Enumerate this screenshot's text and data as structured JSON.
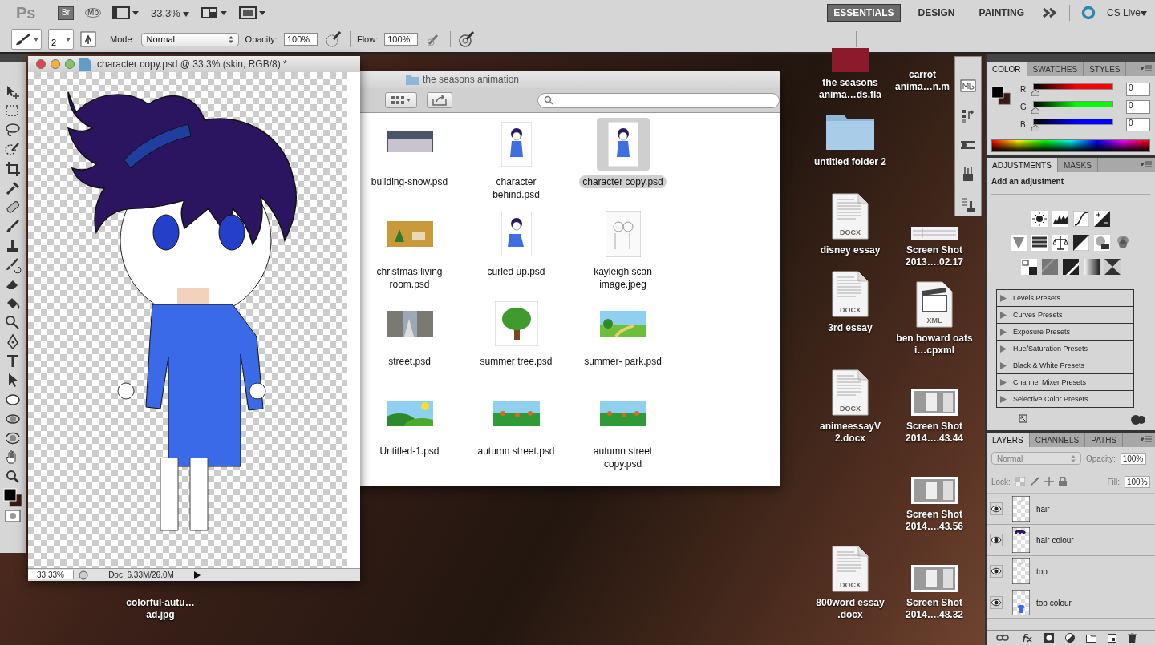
{
  "app_bar": {
    "logo": "Ps",
    "bridge": "Br",
    "mini_bridge": "Mb",
    "zoom": "33.3%",
    "cs_live": "CS Live",
    "workspaces": [
      {
        "label": "ESSENTIALS",
        "selected": true
      },
      {
        "label": "DESIGN",
        "selected": false
      },
      {
        "label": "PAINTING",
        "selected": false
      }
    ]
  },
  "options_bar": {
    "brush_size": "2",
    "mode_label": "Mode:",
    "mode": "Normal",
    "opacity_label": "Opacity:",
    "opacity": "100%",
    "flow_label": "Flow:",
    "flow": "100%"
  },
  "document": {
    "title": "character copy.psd @ 33.3% (skin, RGB/8) *",
    "zoom": "33.33%",
    "doc_info": "Doc: 6.33M/26.0M"
  },
  "finder": {
    "title": "the seasons animation",
    "files": [
      {
        "name": "building-snow.psd",
        "kind": "snow",
        "selected": false
      },
      {
        "name": "character behind.psd",
        "kind": "character",
        "selected": false
      },
      {
        "name": "character copy.psd",
        "kind": "character",
        "selected": true
      },
      {
        "name": "christmas living room.psd",
        "kind": "room",
        "selected": false
      },
      {
        "name": "curled up.psd",
        "kind": "sitting",
        "selected": false
      },
      {
        "name": "kayleigh scan image.jpeg",
        "kind": "sketch",
        "selected": false
      },
      {
        "name": "street.psd",
        "kind": "street",
        "selected": false
      },
      {
        "name": "summer tree.psd",
        "kind": "tree",
        "selected": false
      },
      {
        "name": "summer- park.psd",
        "kind": "park",
        "selected": false
      },
      {
        "name": "Untitled-1.psd",
        "kind": "hills",
        "selected": false
      },
      {
        "name": "autumn street.psd",
        "kind": "autumn",
        "selected": false
      },
      {
        "name": "autumn street copy.psd",
        "kind": "autumn",
        "selected": false
      }
    ]
  },
  "desktop_icons": [
    {
      "label": "carrot anima…n.m"
    },
    {
      "label": "the seasons anima…ds.fla",
      "kind": "fla"
    },
    {
      "label": "untitled folder 2",
      "kind": "folder"
    },
    {
      "label": "disney essay",
      "kind": "docx",
      "badge": "DOCX"
    },
    {
      "label": "Screen Shot 2013….02.17",
      "kind": "strip"
    },
    {
      "label": "3rd essay",
      "kind": "docx",
      "badge": "DOCX"
    },
    {
      "label": "ben howard oats i…cpxml",
      "kind": "xml",
      "badge": "XML"
    },
    {
      "label": "animeessayV 2.docx",
      "kind": "docx",
      "badge": "DOCX"
    },
    {
      "label": "Screen Shot 2014….43.44",
      "kind": "screenshot"
    },
    {
      "label": "Screen Shot 2014….43.56",
      "kind": "screenshot"
    },
    {
      "label": "colorful-autu…ad.jpg"
    },
    {
      "label": "800word essay .docx",
      "kind": "docx",
      "badge": "DOCX"
    },
    {
      "label": "Screen Shot 2014….48.32",
      "kind": "screenshot"
    }
  ],
  "panels": {
    "color": {
      "tabs": [
        {
          "label": "COLOR",
          "selected": true
        },
        {
          "label": "SWATCHES",
          "selected": false
        },
        {
          "label": "STYLES",
          "selected": false
        }
      ],
      "channels": [
        {
          "name": "R",
          "value": "0",
          "level": 0,
          "color": "#ff0000"
        },
        {
          "name": "G",
          "value": "0",
          "level": 0,
          "color": "#00ff00"
        },
        {
          "name": "B",
          "value": "0",
          "level": 0,
          "color": "#0000ff"
        }
      ]
    },
    "adjustments": {
      "tabs": [
        {
          "label": "ADJUSTMENTS",
          "selected": true
        },
        {
          "label": "MASKS",
          "selected": false
        }
      ],
      "heading": "Add an adjustment",
      "presets": [
        {
          "label": "Levels Presets",
          "expanded": false
        },
        {
          "label": "Curves Presets",
          "expanded": false
        },
        {
          "label": "Exposure Presets",
          "expanded": false
        },
        {
          "label": "Hue/Saturation Presets",
          "expanded": false
        },
        {
          "label": "Black & White Presets",
          "expanded": false
        },
        {
          "label": "Channel Mixer Presets",
          "expanded": false
        },
        {
          "label": "Selective Color Presets",
          "expanded": false
        }
      ]
    },
    "layers": {
      "tabs": [
        {
          "label": "LAYERS",
          "selected": true
        },
        {
          "label": "CHANNELS",
          "selected": false
        },
        {
          "label": "PATHS",
          "selected": false
        }
      ],
      "blend_mode": "Normal",
      "opacity_label": "Opacity:",
      "opacity": "100%",
      "lock_label": "Lock:",
      "fill_label": "Fill:",
      "fill": "100%",
      "layers": [
        {
          "name": "hair",
          "visible": true,
          "kind": "lines"
        },
        {
          "name": "hair colour",
          "visible": true,
          "kind": "hair"
        },
        {
          "name": "top",
          "visible": true,
          "kind": "lines"
        },
        {
          "name": "top colour",
          "visible": true,
          "kind": "shirt"
        }
      ]
    }
  }
}
